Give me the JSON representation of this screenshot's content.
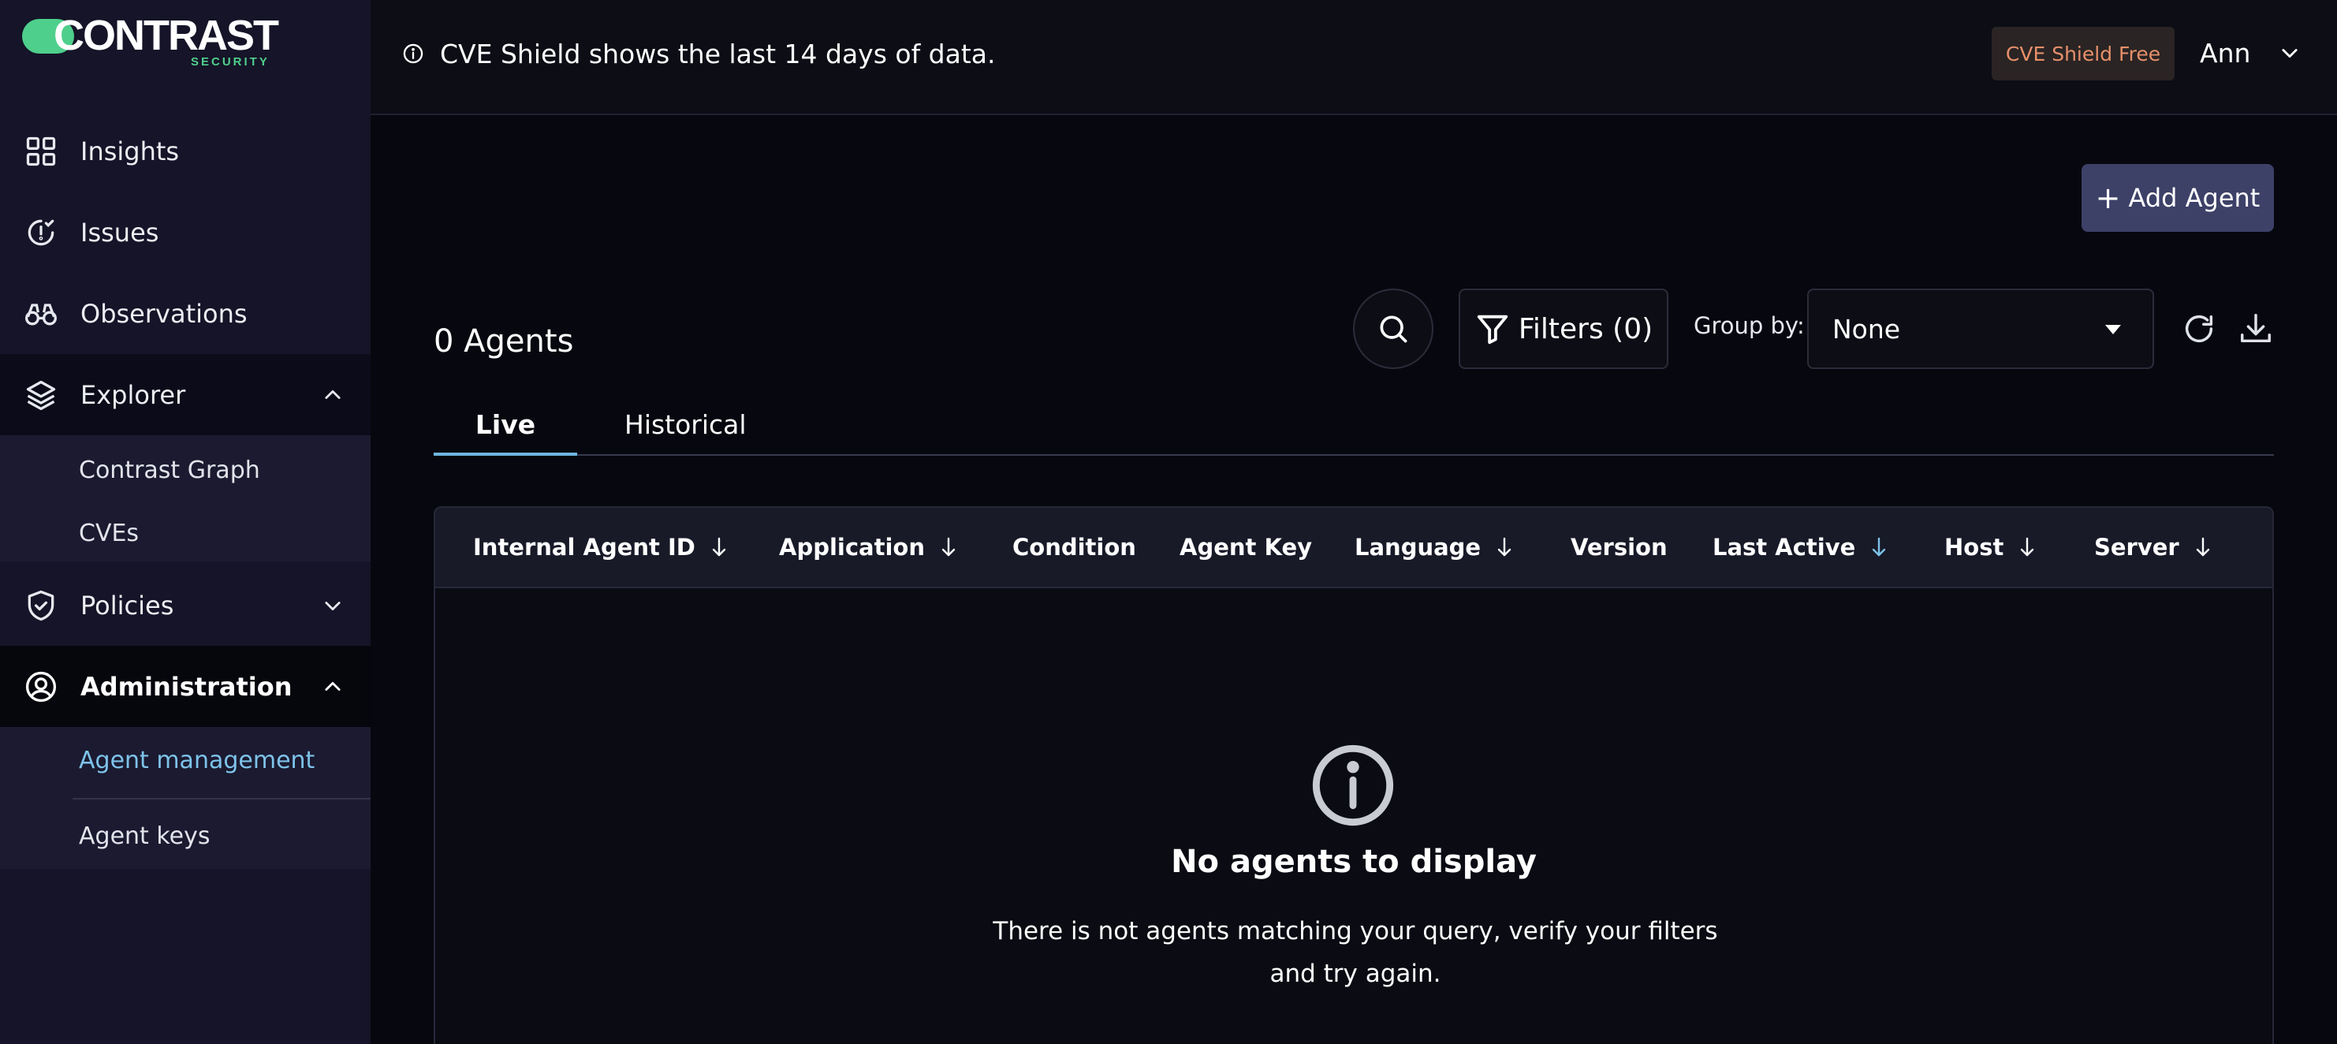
{
  "brand": {
    "name": "CONTRAST",
    "tagline": "SECURITY",
    "accent": "#4fcf8c"
  },
  "sidebar": {
    "items": [
      {
        "label": "Insights",
        "icon": "grid-icon"
      },
      {
        "label": "Issues",
        "icon": "clock-check-icon"
      },
      {
        "label": "Observations",
        "icon": "binoculars-icon"
      },
      {
        "label": "Explorer",
        "icon": "layers-icon",
        "expanded": true,
        "children": [
          {
            "label": "Contrast Graph"
          },
          {
            "label": "CVEs"
          }
        ]
      },
      {
        "label": "Policies",
        "icon": "shield-check-icon",
        "expanded": false
      },
      {
        "label": "Administration",
        "icon": "user-circle-icon",
        "expanded": true,
        "children": [
          {
            "label": "Agent management",
            "active": true
          },
          {
            "label": "Agent keys"
          }
        ]
      }
    ]
  },
  "topbar": {
    "banner": "CVE Shield shows the last 14 days of data.",
    "plan_badge": "CVE Shield Free",
    "user_name": "Ann"
  },
  "main": {
    "add_button": "Add Agent",
    "count_label": "0 Agents",
    "filters_label": "Filters (0)",
    "group_by_label": "Group by:",
    "group_by_value": "None",
    "tabs": [
      {
        "label": "Live",
        "active": true
      },
      {
        "label": "Historical",
        "active": false
      }
    ],
    "columns": [
      {
        "label": "Internal Agent ID",
        "sortable": true
      },
      {
        "label": "Application",
        "sortable": true
      },
      {
        "label": "Condition",
        "sortable": false
      },
      {
        "label": "Agent Key",
        "sortable": false
      },
      {
        "label": "Language",
        "sortable": true
      },
      {
        "label": "Version",
        "sortable": false
      },
      {
        "label": "Last Active",
        "sortable": true,
        "active_sort": true
      },
      {
        "label": "Host",
        "sortable": true
      },
      {
        "label": "Server",
        "sortable": true
      }
    ],
    "empty_state": {
      "title": "No agents to display",
      "description_line1": "There is not agents matching your query, verify your filters",
      "description_line2": "and try again."
    }
  },
  "colors": {
    "active_link": "#7ec3ea",
    "primary_button": "#3d4168",
    "badge_text": "#e6906a"
  }
}
